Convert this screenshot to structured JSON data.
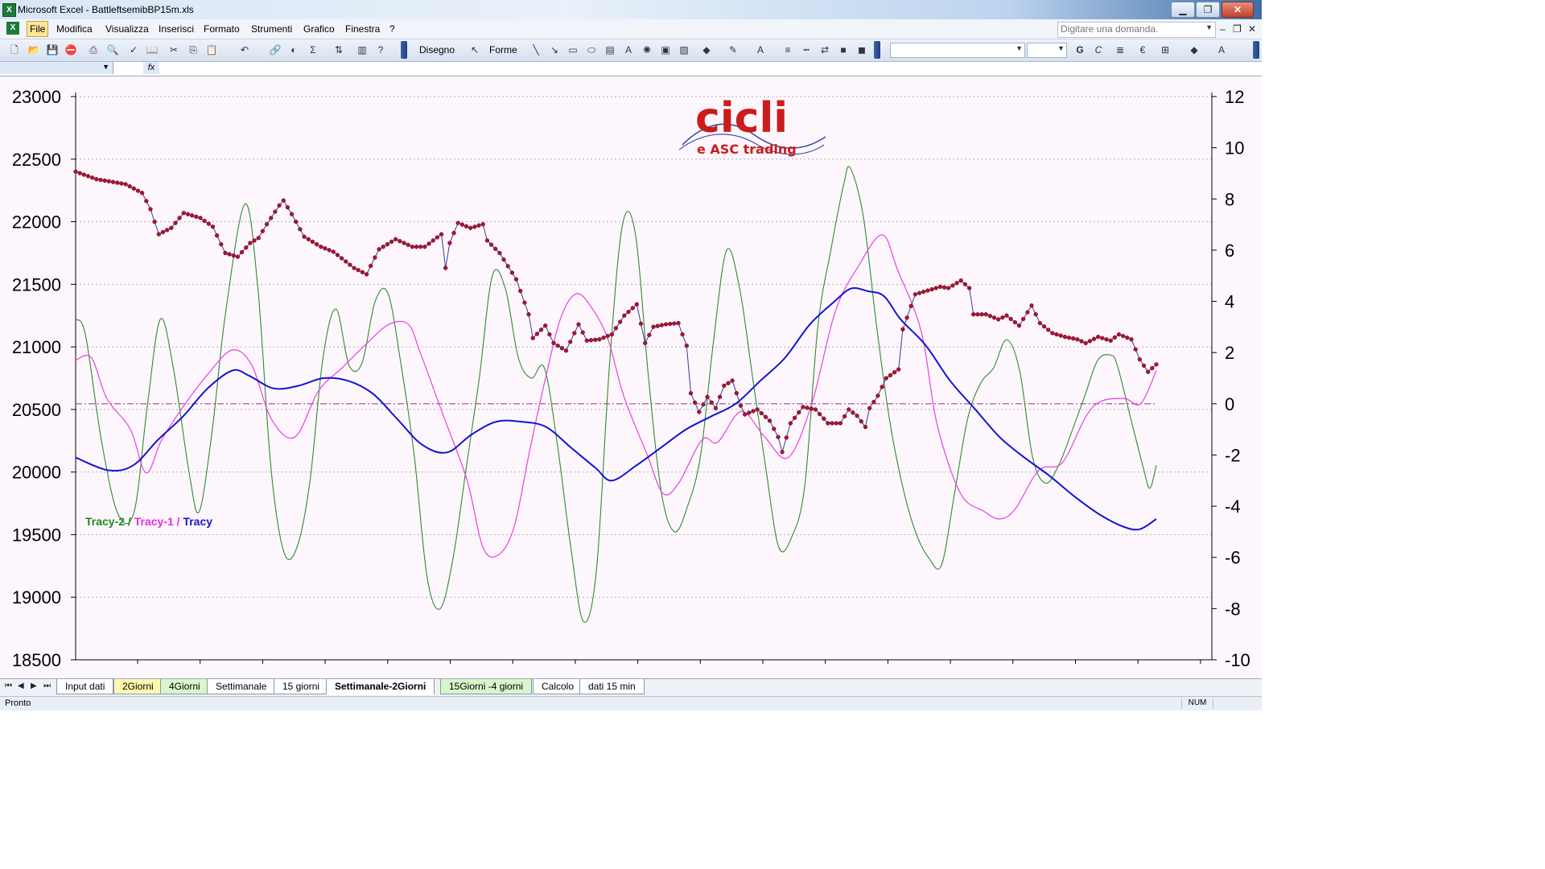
{
  "window": {
    "app_title": "Microsoft Excel - BattleftsemibBP15m.xls",
    "minimize": "▁",
    "restore": "❐",
    "close": "✕"
  },
  "menu": {
    "items": [
      "File",
      "Modifica",
      "Visualizza",
      "Inserisci",
      "Formato",
      "Strumenti",
      "Grafico",
      "Finestra",
      "?"
    ],
    "ask_placeholder": "Digitare una domanda."
  },
  "toolbar": {
    "disegno_label": "Disegno",
    "forme_label": "Forme",
    "font_bold": "G",
    "font_italic": "C"
  },
  "formula_bar": {
    "name_value": "",
    "fx": "fx"
  },
  "logo": {
    "main": "cicli",
    "sub": "e ASC trading"
  },
  "legend": {
    "tracy2": "Tracy-2",
    "tracy1": "Tracy-1",
    "tracy": "Tracy",
    "separator": " / "
  },
  "sheet_tabs": [
    {
      "label": "Input dati",
      "style": "normal"
    },
    {
      "label": "2Giorni",
      "style": "yellow"
    },
    {
      "label": "4Giorni",
      "style": "green"
    },
    {
      "label": "Settimanale",
      "style": "normal"
    },
    {
      "label": "15 giorni",
      "style": "normal"
    },
    {
      "label": "Settimanale-2Giorni",
      "style": "active"
    },
    {
      "label": "15Giorni -4 giorni",
      "style": "green"
    },
    {
      "label": "Calcolo",
      "style": "normal"
    },
    {
      "label": "dati 15 min",
      "style": "normal"
    }
  ],
  "status": {
    "text": "Pronto",
    "num": "NUM"
  },
  "colors": {
    "price": "#a8143c",
    "price_line": "#3a3a9a",
    "tracy": "#1414d2",
    "tracy1": "#ea3fe0",
    "tracy2": "#2e8b2e",
    "zero_line": "#a0429a",
    "plot_bg": "#fdf7fd",
    "logo": "#cc1b1b"
  },
  "chart_data": {
    "type": "line",
    "left_axis": {
      "min": 18500,
      "max": 23000,
      "ticks": [
        23000,
        22500,
        22000,
        21500,
        21000,
        20500,
        20000,
        19500,
        19000,
        18500
      ]
    },
    "right_axis": {
      "min": -10,
      "max": 12,
      "ticks": [
        12,
        10,
        8,
        6,
        4,
        2,
        0,
        -2,
        -4,
        -6,
        -8,
        -10
      ]
    },
    "zero_reference": 0,
    "grid": "horizontal dotted",
    "price_knots": [
      [
        0,
        22400
      ],
      [
        5,
        22340
      ],
      [
        12,
        22300
      ],
      [
        16,
        22230
      ],
      [
        18,
        22100
      ],
      [
        20,
        21900
      ],
      [
        23,
        21950
      ],
      [
        26,
        22070
      ],
      [
        30,
        22030
      ],
      [
        33,
        21960
      ],
      [
        36,
        21750
      ],
      [
        39,
        21720
      ],
      [
        42,
        21830
      ],
      [
        44,
        21870
      ],
      [
        46,
        21980
      ],
      [
        49,
        22130
      ],
      [
        50,
        22170
      ],
      [
        52,
        22060
      ],
      [
        55,
        21880
      ],
      [
        59,
        21800
      ],
      [
        62,
        21760
      ],
      [
        67,
        21630
      ],
      [
        70,
        21580
      ],
      [
        73,
        21780
      ],
      [
        77,
        21860
      ],
      [
        81,
        21800
      ],
      [
        84,
        21800
      ],
      [
        88,
        21900
      ],
      [
        89,
        21630
      ],
      [
        90,
        21830
      ],
      [
        92,
        21990
      ],
      [
        95,
        21950
      ],
      [
        98,
        21980
      ],
      [
        99,
        21850
      ],
      [
        102,
        21750
      ],
      [
        106,
        21540
      ],
      [
        109,
        21260
      ],
      [
        110,
        21070
      ],
      [
        113,
        21170
      ],
      [
        115,
        21030
      ],
      [
        118,
        20970
      ],
      [
        121,
        21180
      ],
      [
        123,
        21050
      ],
      [
        126,
        21060
      ],
      [
        129,
        21100
      ],
      [
        132,
        21250
      ],
      [
        135,
        21340
      ],
      [
        137,
        21030
      ],
      [
        139,
        21160
      ],
      [
        142,
        21180
      ],
      [
        145,
        21190
      ],
      [
        147,
        21010
      ],
      [
        148,
        20630
      ],
      [
        150,
        20480
      ],
      [
        152,
        20600
      ],
      [
        154,
        20510
      ],
      [
        156,
        20690
      ],
      [
        158,
        20730
      ],
      [
        160,
        20530
      ],
      [
        161,
        20460
      ],
      [
        164,
        20500
      ],
      [
        167,
        20410
      ],
      [
        169,
        20280
      ],
      [
        170,
        20160
      ],
      [
        172,
        20390
      ],
      [
        175,
        20520
      ],
      [
        178,
        20500
      ],
      [
        181,
        20390
      ],
      [
        184,
        20390
      ],
      [
        186,
        20500
      ],
      [
        188,
        20450
      ],
      [
        190,
        20360
      ],
      [
        191,
        20510
      ],
      [
        193,
        20610
      ],
      [
        195,
        20750
      ],
      [
        198,
        20820
      ],
      [
        199,
        21140
      ],
      [
        202,
        21420
      ],
      [
        205,
        21450
      ],
      [
        208,
        21480
      ],
      [
        210,
        21470
      ],
      [
        213,
        21530
      ],
      [
        215,
        21470
      ],
      [
        216,
        21260
      ],
      [
        219,
        21260
      ],
      [
        222,
        21220
      ],
      [
        224,
        21250
      ],
      [
        227,
        21170
      ],
      [
        230,
        21330
      ],
      [
        232,
        21190
      ],
      [
        235,
        21110
      ],
      [
        238,
        21080
      ],
      [
        241,
        21060
      ],
      [
        243,
        21030
      ],
      [
        246,
        21080
      ],
      [
        249,
        21050
      ],
      [
        251,
        21100
      ],
      [
        254,
        21060
      ],
      [
        256,
        20900
      ],
      [
        258,
        20800
      ],
      [
        260,
        20860
      ]
    ],
    "tracy_knots": [
      [
        0,
        -2.1
      ],
      [
        8,
        -2.6
      ],
      [
        14,
        -2.4
      ],
      [
        20,
        -1.4
      ],
      [
        26,
        -0.5
      ],
      [
        32,
        0.6
      ],
      [
        38,
        1.3
      ],
      [
        42,
        1.1
      ],
      [
        48,
        0.6
      ],
      [
        54,
        0.7
      ],
      [
        60,
        1.0
      ],
      [
        66,
        0.9
      ],
      [
        72,
        0.4
      ],
      [
        78,
        -0.6
      ],
      [
        84,
        -1.6
      ],
      [
        90,
        -1.9
      ],
      [
        96,
        -1.2
      ],
      [
        102,
        -0.7
      ],
      [
        108,
        -0.7
      ],
      [
        114,
        -0.9
      ],
      [
        120,
        -1.7
      ],
      [
        126,
        -2.5
      ],
      [
        130,
        -3.0
      ],
      [
        136,
        -2.4
      ],
      [
        142,
        -1.7
      ],
      [
        148,
        -1.0
      ],
      [
        154,
        -0.5
      ],
      [
        160,
        0.0
      ],
      [
        166,
        0.9
      ],
      [
        172,
        1.8
      ],
      [
        178,
        3.1
      ],
      [
        184,
        4.0
      ],
      [
        188,
        4.5
      ],
      [
        192,
        4.4
      ],
      [
        196,
        4.2
      ],
      [
        200,
        3.3
      ],
      [
        206,
        2.3
      ],
      [
        212,
        0.9
      ],
      [
        218,
        -0.2
      ],
      [
        224,
        -1.3
      ],
      [
        230,
        -2.1
      ],
      [
        236,
        -2.8
      ],
      [
        242,
        -3.6
      ],
      [
        248,
        -4.3
      ],
      [
        254,
        -4.8
      ],
      [
        258,
        -4.9
      ],
      [
        262,
        -4.5
      ]
    ],
    "tracy1_knots": [
      [
        0,
        1.7
      ],
      [
        4,
        1.8
      ],
      [
        8,
        0.2
      ],
      [
        14,
        -1.0
      ],
      [
        18,
        -2.7
      ],
      [
        22,
        -1.4
      ],
      [
        28,
        0.0
      ],
      [
        34,
        1.2
      ],
      [
        40,
        2.1
      ],
      [
        45,
        1.5
      ],
      [
        50,
        -0.6
      ],
      [
        56,
        -1.3
      ],
      [
        62,
        0.5
      ],
      [
        68,
        1.4
      ],
      [
        74,
        2.3
      ],
      [
        80,
        3.1
      ],
      [
        85,
        3.1
      ],
      [
        88,
        2.0
      ],
      [
        94,
        -0.5
      ],
      [
        100,
        -3.0
      ],
      [
        104,
        -5.6
      ],
      [
        108,
        -5.9
      ],
      [
        112,
        -4.8
      ],
      [
        116,
        -1.8
      ],
      [
        120,
        1.0
      ],
      [
        124,
        3.4
      ],
      [
        128,
        4.3
      ],
      [
        132,
        3.7
      ],
      [
        136,
        2.5
      ],
      [
        140,
        0.3
      ],
      [
        146,
        -2.0
      ],
      [
        150,
        -3.5
      ],
      [
        154,
        -3.1
      ],
      [
        160,
        -1.4
      ],
      [
        164,
        -1.5
      ],
      [
        170,
        -0.3
      ],
      [
        176,
        -1.3
      ],
      [
        182,
        -2.1
      ],
      [
        188,
        0.0
      ],
      [
        194,
        3.6
      ],
      [
        200,
        5.4
      ],
      [
        206,
        6.6
      ],
      [
        210,
        5.2
      ],
      [
        216,
        2.8
      ],
      [
        220,
        -0.8
      ],
      [
        226,
        -3.5
      ],
      [
        232,
        -4.2
      ],
      [
        236,
        -4.5
      ],
      [
        240,
        -4.1
      ],
      [
        246,
        -2.6
      ],
      [
        252,
        -2.3
      ],
      [
        258,
        -0.5
      ],
      [
        262,
        0.1
      ],
      [
        268,
        0.2
      ],
      [
        272,
        0.0
      ],
      [
        276,
        1.3
      ]
    ],
    "tracy2_knots": [
      [
        0,
        3.3
      ],
      [
        3,
        2.7
      ],
      [
        8,
        -1.5
      ],
      [
        13,
        -4.3
      ],
      [
        18,
        -4.2
      ],
      [
        22,
        -0.1
      ],
      [
        26,
        3.3
      ],
      [
        30,
        1.4
      ],
      [
        35,
        -2.8
      ],
      [
        38,
        -4.2
      ],
      [
        42,
        -1.0
      ],
      [
        46,
        3.5
      ],
      [
        52,
        7.8
      ],
      [
        56,
        4.5
      ],
      [
        60,
        -2.5
      ],
      [
        64,
        -5.8
      ],
      [
        68,
        -5.6
      ],
      [
        72,
        -3.0
      ],
      [
        76,
        1.8
      ],
      [
        80,
        3.7
      ],
      [
        84,
        1.5
      ],
      [
        88,
        1.6
      ],
      [
        92,
        4.0
      ],
      [
        96,
        4.3
      ],
      [
        100,
        1.5
      ],
      [
        104,
        -2.0
      ],
      [
        108,
        -6.8
      ],
      [
        112,
        -8.0
      ],
      [
        116,
        -6.0
      ],
      [
        120,
        -2.5
      ],
      [
        124,
        1.0
      ],
      [
        128,
        5.0
      ],
      [
        132,
        4.5
      ],
      [
        136,
        1.8
      ],
      [
        140,
        1.0
      ],
      [
        144,
        1.4
      ],
      [
        148,
        -1.6
      ],
      [
        152,
        -5.5
      ],
      [
        156,
        -8.5
      ],
      [
        160,
        -6.5
      ],
      [
        164,
        1.5
      ],
      [
        168,
        7.0
      ],
      [
        172,
        6.6
      ],
      [
        176,
        1.0
      ],
      [
        180,
        -3.5
      ],
      [
        184,
        -5.0
      ],
      [
        188,
        -4.0
      ],
      [
        192,
        -2.0
      ],
      [
        196,
        2.5
      ],
      [
        200,
        6.0
      ],
      [
        204,
        4.5
      ],
      [
        208,
        1.0
      ],
      [
        212,
        -2.5
      ],
      [
        216,
        -5.6
      ],
      [
        220,
        -5.2
      ],
      [
        224,
        -3.2
      ],
      [
        228,
        3.0
      ],
      [
        232,
        6.0
      ],
      [
        236,
        8.6
      ],
      [
        238,
        9.2
      ],
      [
        242,
        7.3
      ],
      [
        246,
        3.1
      ],
      [
        250,
        -0.6
      ],
      [
        254,
        -3.2
      ],
      [
        258,
        -5.0
      ],
      [
        262,
        -6.0
      ],
      [
        266,
        -6.3
      ],
      [
        270,
        -3.5
      ],
      [
        274,
        -0.6
      ],
      [
        278,
        0.8
      ],
      [
        282,
        1.4
      ],
      [
        286,
        2.5
      ],
      [
        290,
        1.3
      ],
      [
        294,
        -2.1
      ],
      [
        298,
        -3.1
      ],
      [
        302,
        -2.4
      ],
      [
        306,
        -1.1
      ],
      [
        310,
        0.3
      ],
      [
        314,
        1.7
      ],
      [
        318,
        1.9
      ],
      [
        320,
        1.5
      ],
      [
        324,
        -0.5
      ],
      [
        328,
        -2.5
      ],
      [
        330,
        -3.3
      ],
      [
        332,
        -2.4
      ]
    ]
  }
}
